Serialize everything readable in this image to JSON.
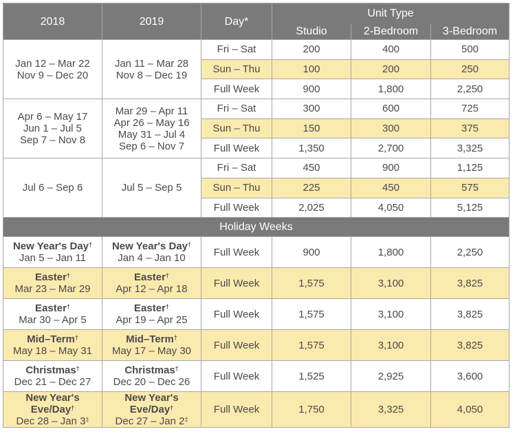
{
  "headers": {
    "year1": "2018",
    "year2": "2019",
    "day": "Day*",
    "unit_type": "Unit Type",
    "studio": "Studio",
    "two_bedroom": "2-Bedroom",
    "three_bedroom": "3-Bedroom"
  },
  "seasons": [
    {
      "dates_2018": [
        "Jan 12 – Mar 22",
        "Nov 9 – Dec 20"
      ],
      "dates_2019": [
        "Jan 11 – Mar 28",
        "Nov 8 – Dec 19"
      ],
      "rows": [
        {
          "day": "Fri – Sat",
          "studio": "200",
          "two": "400",
          "three": "500"
        },
        {
          "day": "Sun – Thu",
          "studio": "100",
          "two": "200",
          "three": "250"
        },
        {
          "day": "Full Week",
          "studio": "900",
          "two": "1,800",
          "three": "2,250"
        }
      ]
    },
    {
      "dates_2018": [
        "Apr 6 – May 17",
        "Jun 1 – Jul 5",
        "Sep 7 – Nov 8"
      ],
      "dates_2019": [
        "Mar 29 – Apr 11",
        "Apr 26 – May 16",
        "May 31 – Jul 4",
        "Sep 6 – Nov 7"
      ],
      "rows": [
        {
          "day": "Fri – Sat",
          "studio": "300",
          "two": "600",
          "three": "725"
        },
        {
          "day": "Sun – Thu",
          "studio": "150",
          "two": "300",
          "three": "375"
        },
        {
          "day": "Full Week",
          "studio": "1,350",
          "two": "2,700",
          "three": "3,325"
        }
      ]
    },
    {
      "dates_2018": [
        "Jul 6 – Sep 6"
      ],
      "dates_2019": [
        "Jul 5 – Sep 5"
      ],
      "rows": [
        {
          "day": "Fri – Sat",
          "studio": "450",
          "two": "900",
          "three": "1,125"
        },
        {
          "day": "Sun – Thu",
          "studio": "225",
          "two": "450",
          "three": "575"
        },
        {
          "day": "Full Week",
          "studio": "2,025",
          "two": "4,050",
          "three": "5,125"
        }
      ]
    }
  ],
  "holiday_banner": "Holiday Weeks",
  "holidays": [
    {
      "name_2018": "New Year's Day",
      "mark_2018": "†",
      "dates_2018": "Jan 5 – Jan 11",
      "date_mark_2018": "",
      "name_2019": "New Year's Day",
      "mark_2019": "†",
      "dates_2019": "Jan 4 – Jan 10",
      "date_mark_2019": "",
      "day": "Full Week",
      "studio": "900",
      "two": "1,800",
      "three": "2,250"
    },
    {
      "name_2018": "Easter",
      "mark_2018": "†",
      "dates_2018": "Mar 23 – Mar 29",
      "date_mark_2018": "",
      "name_2019": "Easter",
      "mark_2019": "†",
      "dates_2019": "Apr 12 – Apr 18",
      "date_mark_2019": "",
      "day": "Full Week",
      "studio": "1,575",
      "two": "3,100",
      "three": "3,825"
    },
    {
      "name_2018": "Easter",
      "mark_2018": "†",
      "dates_2018": "Mar 30 – Apr 5",
      "date_mark_2018": "",
      "name_2019": "Easter",
      "mark_2019": "†",
      "dates_2019": "Apr 19 – Apr 25",
      "date_mark_2019": "",
      "day": "Full Week",
      "studio": "1,575",
      "two": "3,100",
      "three": "3,825"
    },
    {
      "name_2018": "Mid–Term",
      "mark_2018": "†",
      "dates_2018": "May 18 – May 31",
      "date_mark_2018": "",
      "name_2019": "Mid–Term",
      "mark_2019": "†",
      "dates_2019": "May 17 – May 30",
      "date_mark_2019": "",
      "day": "Full Week",
      "studio": "1,575",
      "two": "3,100",
      "three": "3,825"
    },
    {
      "name_2018": "Christmas",
      "mark_2018": "†",
      "dates_2018": "Dec 21 – Dec 27",
      "date_mark_2018": "",
      "name_2019": "Christmas",
      "mark_2019": "†",
      "dates_2019": "Dec 20 – Dec 26",
      "date_mark_2019": "",
      "day": "Full Week",
      "studio": "1,525",
      "two": "2,925",
      "three": "3,600"
    },
    {
      "name_2018": "New Year's Eve/Day",
      "mark_2018": "†",
      "dates_2018": "Dec 28 – Jan 3",
      "date_mark_2018": "‡",
      "name_2019": "New Year's Eve/Day",
      "mark_2019": "†",
      "dates_2019": "Dec 27 – Jan 2",
      "date_mark_2019": "‡",
      "day": "Full Week",
      "studio": "1,750",
      "two": "3,325",
      "three": "4,050"
    }
  ]
}
